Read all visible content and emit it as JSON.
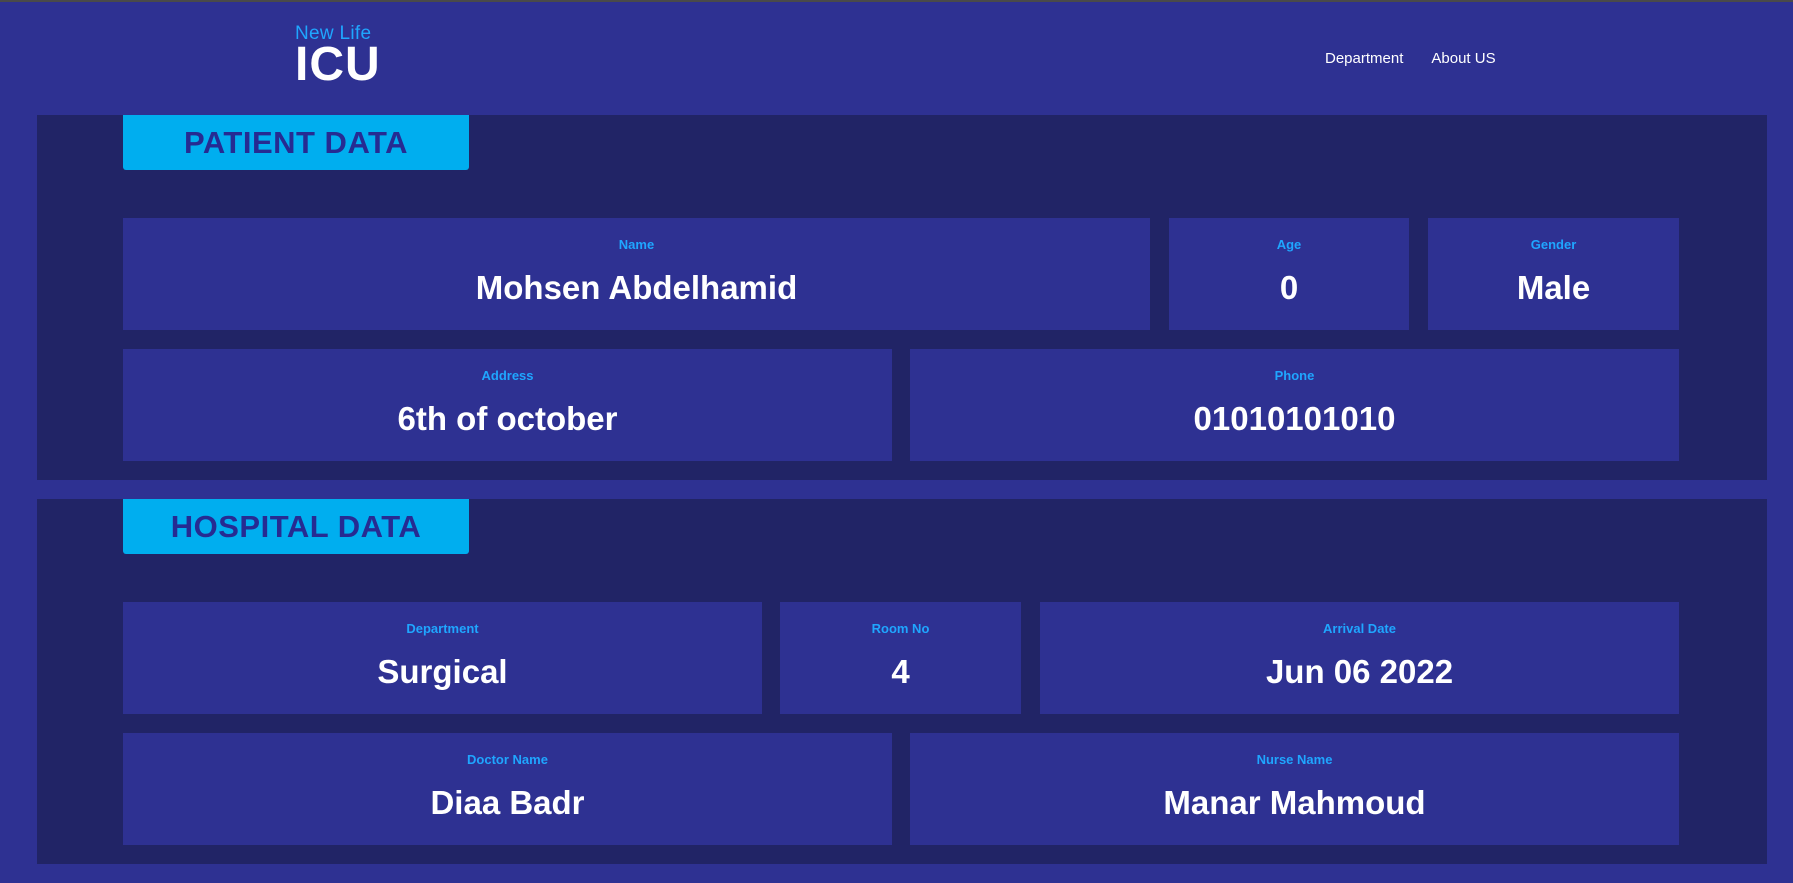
{
  "header": {
    "logo_small": "New Life",
    "logo_big": "ICU",
    "nav": {
      "department": "Department",
      "about": "About US"
    }
  },
  "patient": {
    "title": "PATIENT DATA",
    "name": {
      "label": "Name",
      "value": "Mohsen Abdelhamid"
    },
    "age": {
      "label": "Age",
      "value": "0"
    },
    "gender": {
      "label": "Gender",
      "value": "Male"
    },
    "address": {
      "label": "Address",
      "value": "6th of october"
    },
    "phone": {
      "label": "Phone",
      "value": "01010101010"
    }
  },
  "hospital": {
    "title": "HOSPITAL DATA",
    "department": {
      "label": "Department",
      "value": "Surgical"
    },
    "room": {
      "label": "Room No",
      "value": "4"
    },
    "arrival": {
      "label": "Arrival Date",
      "value": "Jun 06 2022"
    },
    "doctor": {
      "label": "Doctor Name",
      "value": "Diaa Badr"
    },
    "nurse": {
      "label": "Nurse Name",
      "value": "Manar Mahmoud"
    }
  },
  "colors": {
    "background": "#2e3192",
    "section_bg": "#212466",
    "accent": "#00aeef",
    "label": "#1fa6ff",
    "text": "#ffffff"
  }
}
